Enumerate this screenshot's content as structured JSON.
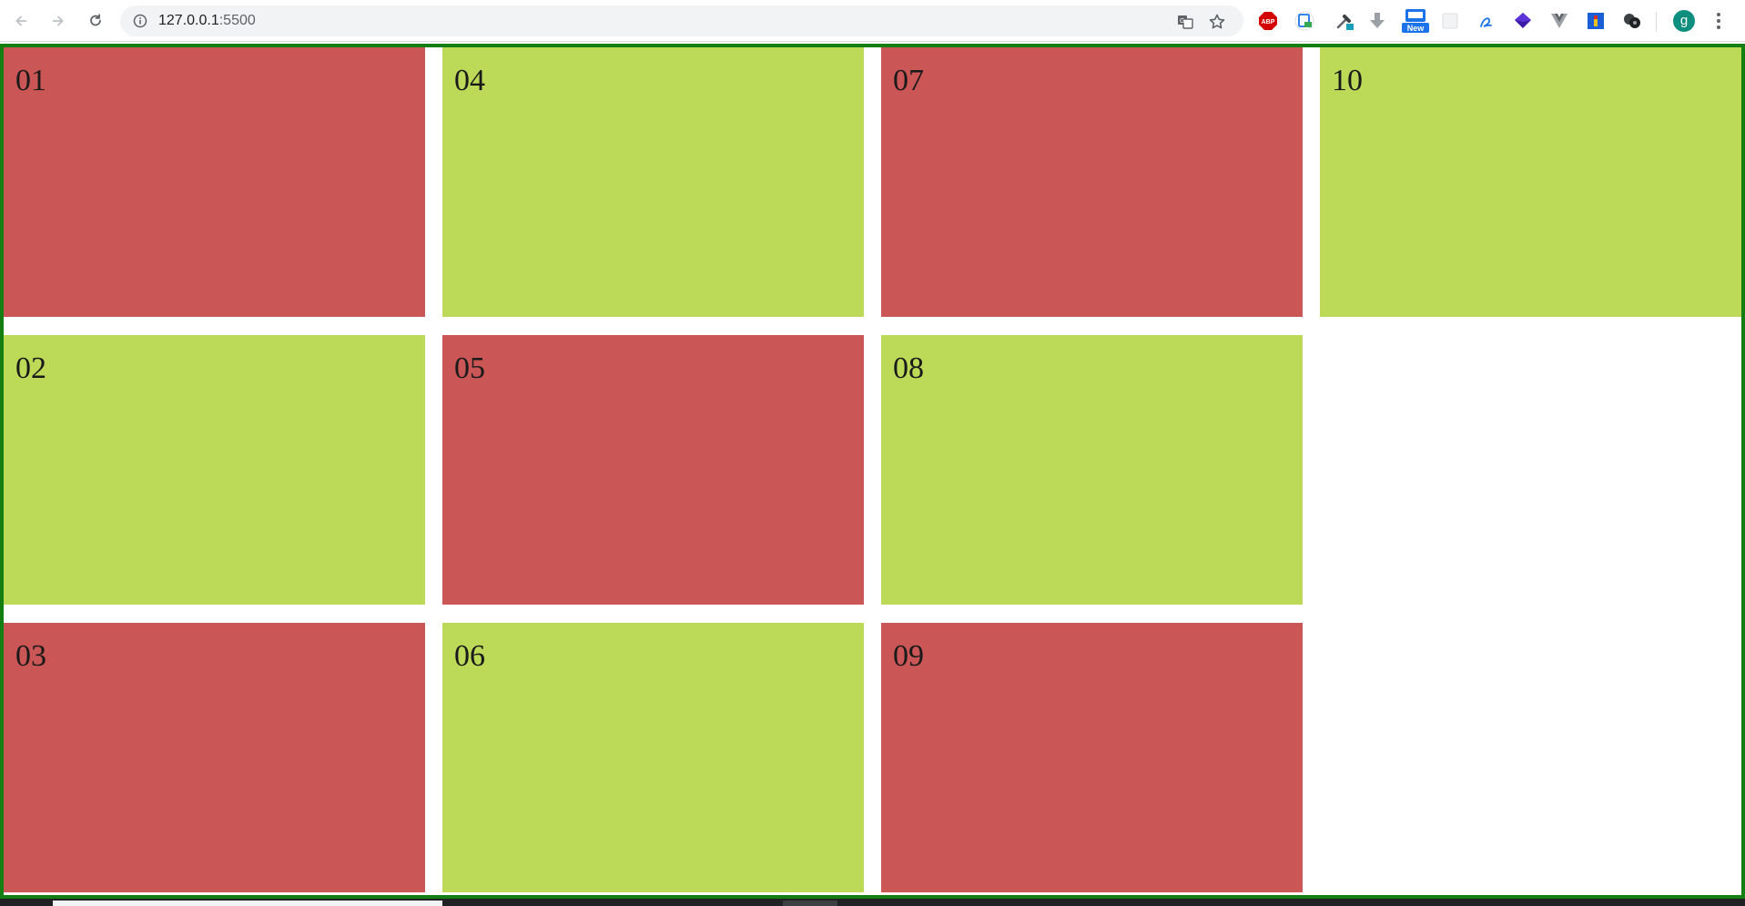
{
  "browser": {
    "url_host": "127.0.0.1",
    "url_port": ":5500",
    "profile_initial": "g",
    "extension_badges": {
      "abp": "ABP",
      "new": "New"
    },
    "extensions": [
      "adblock-plus-icon",
      "screen-share-icon",
      "eyedropper-icon",
      "download-arrow-icon",
      "new-badge-icon",
      "blank-extension-icon",
      "signature-icon",
      "diamond-icon",
      "vue-devtools-icon",
      "flag-icon",
      "bubbles-icon"
    ]
  },
  "colors": {
    "red": "#cb5656",
    "green": "#bcda57",
    "border": "#137f12"
  },
  "grid": {
    "items": [
      {
        "label": "01",
        "color": "red"
      },
      {
        "label": "02",
        "color": "green"
      },
      {
        "label": "03",
        "color": "red"
      },
      {
        "label": "04",
        "color": "green"
      },
      {
        "label": "05",
        "color": "red"
      },
      {
        "label": "06",
        "color": "green"
      },
      {
        "label": "07",
        "color": "red"
      },
      {
        "label": "08",
        "color": "green"
      },
      {
        "label": "09",
        "color": "red"
      },
      {
        "label": "10",
        "color": "green"
      }
    ]
  }
}
